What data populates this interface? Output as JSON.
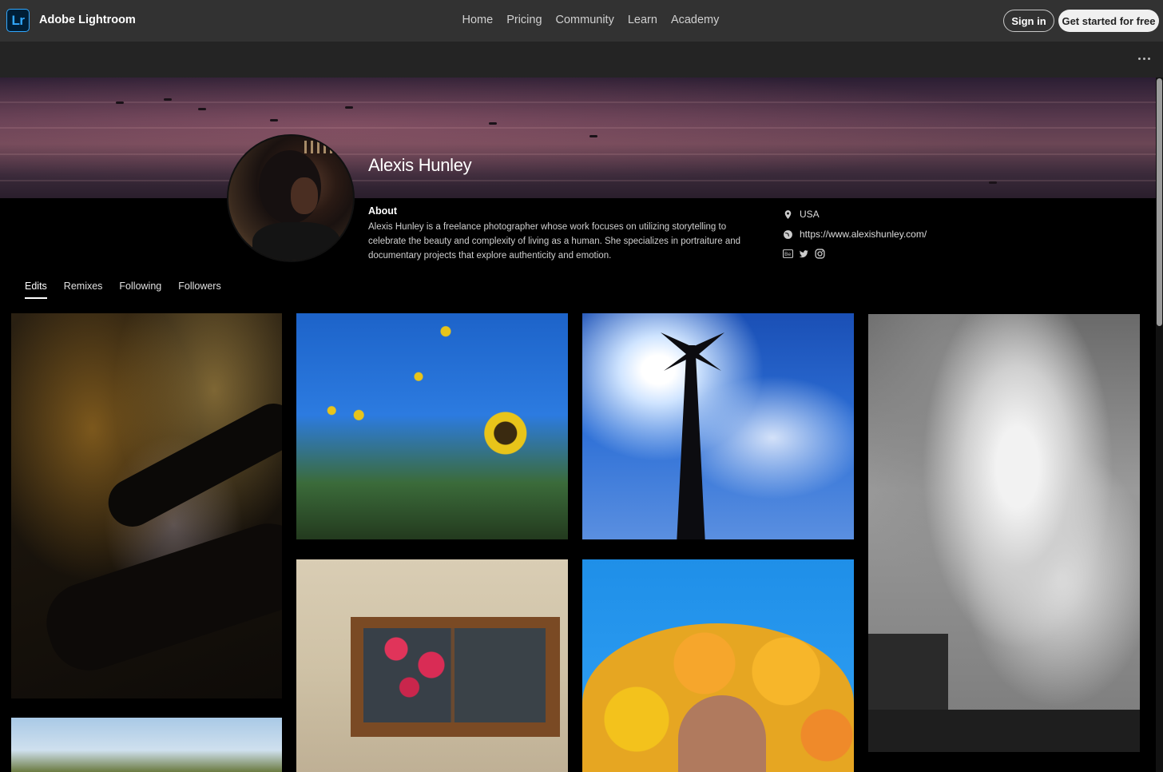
{
  "header": {
    "logo_text": "Lr",
    "brand": "Adobe Lightroom",
    "nav": [
      "Home",
      "Pricing",
      "Community",
      "Learn",
      "Academy"
    ],
    "sign_in": "Sign in",
    "get_started": "Get started for free"
  },
  "profile": {
    "name": "Alexis Hunley",
    "about_heading": "About",
    "about_text": "Alexis Hunley is a freelance photographer whose work focuses on utilizing storytelling to celebrate the beauty and complexity of living as a human. She specializes in portraiture and documentary projects that explore authenticity and emotion.",
    "location": "USA",
    "website": "https://www.alexishunley.com/",
    "social_icons": [
      "behance-icon",
      "twitter-icon",
      "instagram-icon"
    ]
  },
  "tabs": [
    {
      "label": "Edits",
      "active": true
    },
    {
      "label": "Remixes",
      "active": false
    },
    {
      "label": "Following",
      "active": false
    },
    {
      "label": "Followers",
      "active": false
    }
  ],
  "colors": {
    "topbar": "#323232",
    "subbar": "#242424",
    "background": "#000000",
    "lightroom_blue": "#31a8ff"
  }
}
